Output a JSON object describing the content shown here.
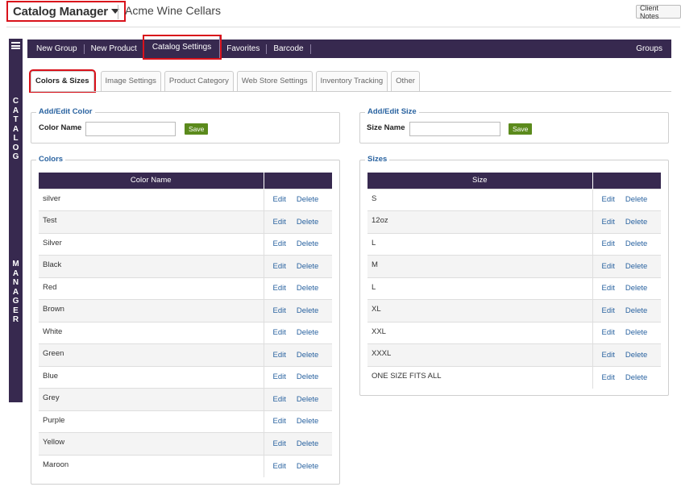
{
  "header": {
    "app_title": "Catalog Manager",
    "company": "Acme Wine Cellars",
    "client_notes": "Client Notes"
  },
  "sidebar": {
    "word1": [
      "C",
      "A",
      "T",
      "A",
      "L",
      "O",
      "G"
    ],
    "word2": [
      "M",
      "A",
      "N",
      "A",
      "G",
      "E",
      "R"
    ]
  },
  "nav": {
    "items": [
      "New Group",
      "New Product",
      "Catalog Settings",
      "Favorites",
      "Barcode"
    ],
    "groups": "Groups"
  },
  "tabs": [
    "Colors & Sizes",
    "Image Settings",
    "Product Category",
    "Web Store Settings",
    "Inventory Tracking",
    "Other"
  ],
  "color_form": {
    "legend": "Add/Edit Color",
    "label": "Color Name",
    "value": "",
    "save": "Save"
  },
  "size_form": {
    "legend": "Add/Edit Size",
    "label": "Size Name",
    "value": "",
    "save": "Save"
  },
  "colors": {
    "legend": "Colors",
    "header": "Color Name",
    "rows": [
      "silver",
      "Test",
      "Silver",
      "Black",
      "Red",
      "Brown",
      "White",
      "Green",
      "Blue",
      "Grey",
      "Purple",
      "Yellow",
      "Maroon"
    ]
  },
  "sizes": {
    "legend": "Sizes",
    "header": "Size",
    "rows": [
      "S",
      "12oz",
      "L",
      "M",
      "L",
      "XL",
      "XXL",
      "XXXL",
      "ONE SIZE FITS ALL"
    ]
  },
  "actions": {
    "edit": "Edit",
    "delete": "Delete"
  }
}
